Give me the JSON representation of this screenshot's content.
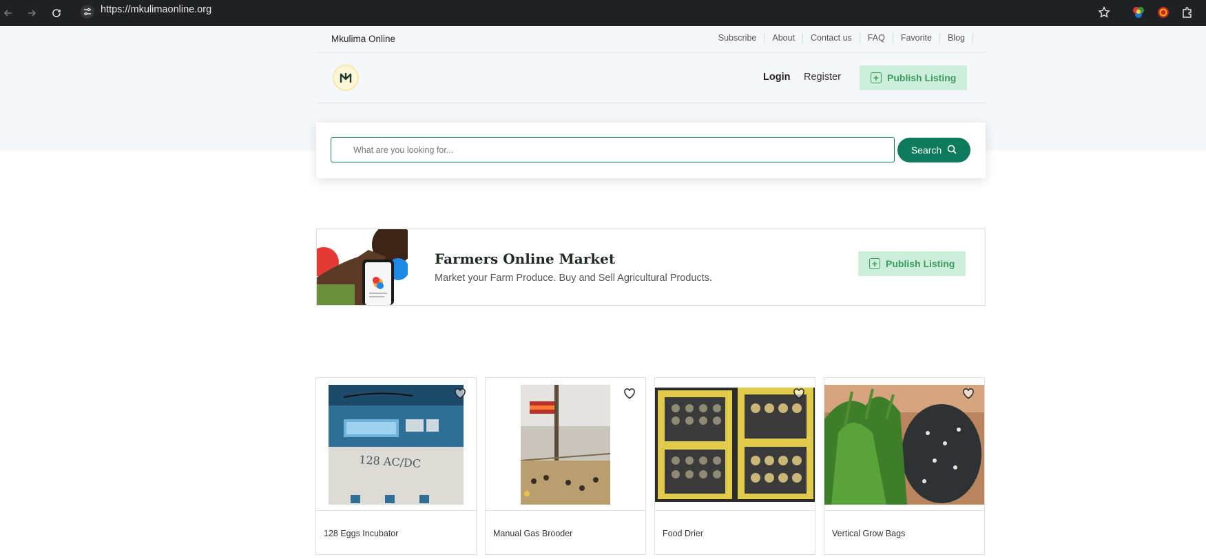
{
  "browser": {
    "url": "https://mkulimaonline.org"
  },
  "topnav": {
    "brand": "Mkulima Online",
    "links": [
      "Subscribe",
      "About",
      "Contact us",
      "FAQ",
      "Favorite",
      "Blog"
    ]
  },
  "header": {
    "login": "Login",
    "register": "Register",
    "publish": "Publish Listing"
  },
  "search": {
    "placeholder": "What are you looking for...",
    "button": "Search"
  },
  "banner": {
    "title": "Farmers Online Market",
    "subtitle": "Market your Farm Produce. Buy and Sell Agricultural Products.",
    "publish": "Publish Listing"
  },
  "products": [
    {
      "title": "128 Eggs Incubator",
      "image_text": "128 AC/DC"
    },
    {
      "title": "Manual Gas Brooder"
    },
    {
      "title": "Food Drier"
    },
    {
      "title": "Vertical Grow Bags"
    }
  ],
  "colors": {
    "accent": "#0e7a5c",
    "publish_bg": "#cdeeda",
    "publish_fg": "#3c9a5f"
  }
}
